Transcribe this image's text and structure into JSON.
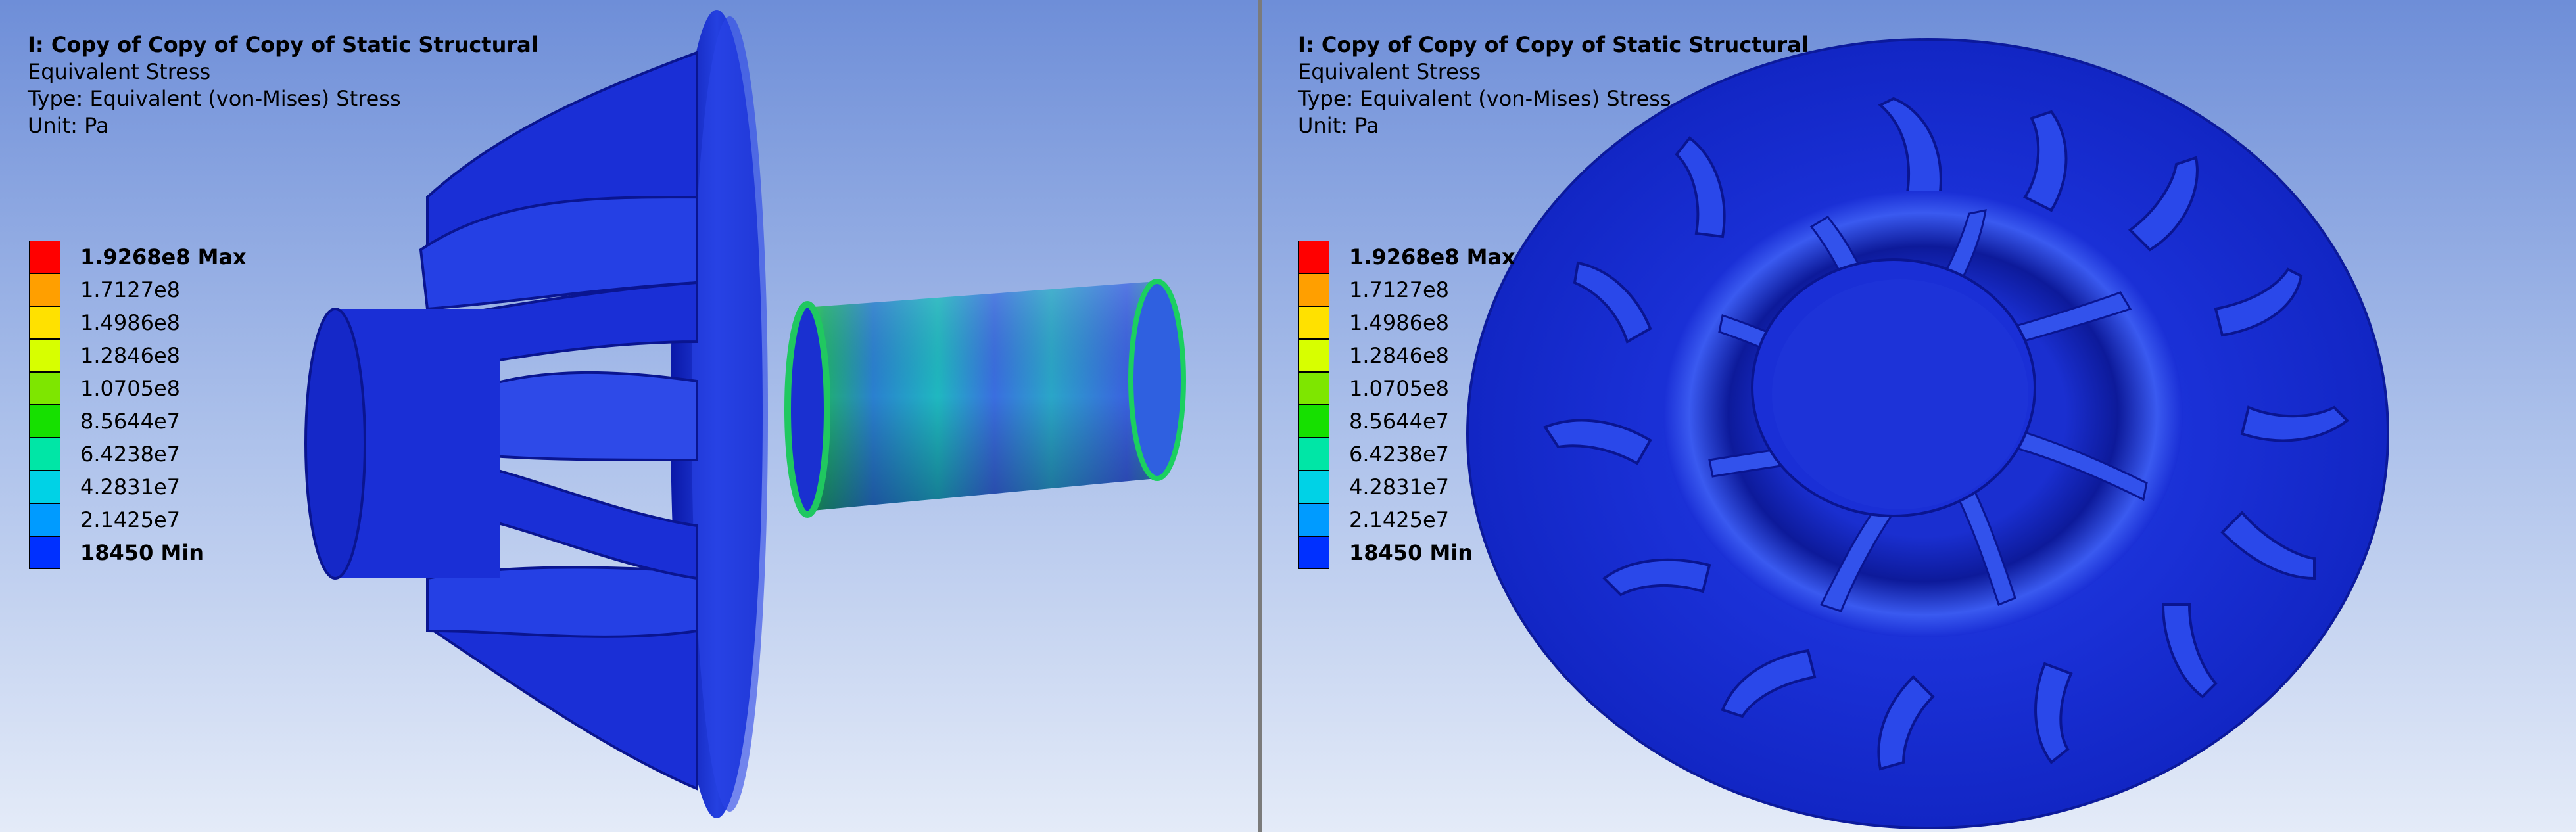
{
  "panels": [
    {
      "id": "left",
      "view": "side-view",
      "header": {
        "title": "I: Copy of Copy of Copy of Static Structural",
        "result": "Equivalent Stress",
        "type": "Type: Equivalent (von-Mises) Stress",
        "unit": "Unit: Pa"
      }
    },
    {
      "id": "right",
      "view": "front-view",
      "header": {
        "title": "I: Copy of Copy of Copy of Static Structural",
        "result": "Equivalent Stress",
        "type": "Type: Equivalent (von-Mises) Stress",
        "unit": "Unit: Pa"
      }
    }
  ],
  "legend": {
    "entries": [
      {
        "label": "1.9268e8 Max",
        "color": "#ff0000",
        "bold": true
      },
      {
        "label": "1.7127e8",
        "color": "#ff9f00",
        "bold": false
      },
      {
        "label": "1.4986e8",
        "color": "#ffe100",
        "bold": false
      },
      {
        "label": "1.2846e8",
        "color": "#d7ff00",
        "bold": false
      },
      {
        "label": "1.0705e8",
        "color": "#7ee600",
        "bold": false
      },
      {
        "label": "8.5644e7",
        "color": "#16e000",
        "bold": false
      },
      {
        "label": "6.4238e7",
        "color": "#00e6a6",
        "bold": false
      },
      {
        "label": "4.2831e7",
        "color": "#00d2e6",
        "bold": false
      },
      {
        "label": "2.1425e7",
        "color": "#009bff",
        "bold": false
      },
      {
        "label": "18450 Min",
        "color": "#0030ff",
        "bold": true
      }
    ]
  },
  "colors": {
    "model_blue": "#1a2fd6",
    "model_dark": "#0a1590",
    "model_light": "#3f5bf0"
  }
}
